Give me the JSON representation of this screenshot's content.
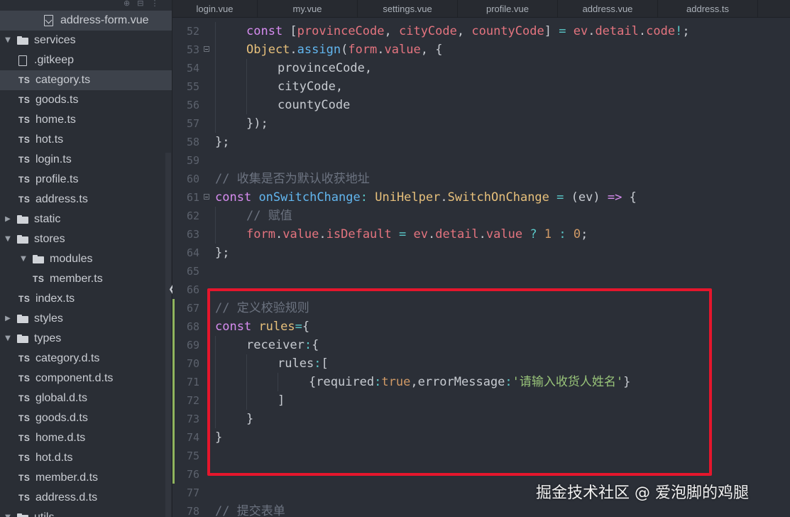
{
  "tabs": [
    {
      "label": "login.vue"
    },
    {
      "label": "my.vue"
    },
    {
      "label": "settings.vue"
    },
    {
      "label": "profile.vue"
    },
    {
      "label": "address.vue"
    },
    {
      "label": "address.ts"
    }
  ],
  "explorer": {
    "items": [
      {
        "label": "address-form.vue",
        "kind": "vue",
        "depth": 3,
        "selected": false
      },
      {
        "label": "services",
        "kind": "folder",
        "depth": 0,
        "expanded": true
      },
      {
        "label": ".gitkeep",
        "kind": "file",
        "depth": 1
      },
      {
        "label": "category.ts",
        "kind": "ts",
        "depth": 1,
        "selected": true
      },
      {
        "label": "goods.ts",
        "kind": "ts",
        "depth": 1
      },
      {
        "label": "home.ts",
        "kind": "ts",
        "depth": 1
      },
      {
        "label": "hot.ts",
        "kind": "ts",
        "depth": 1
      },
      {
        "label": "login.ts",
        "kind": "ts",
        "depth": 1
      },
      {
        "label": "profile.ts",
        "kind": "ts",
        "depth": 1
      },
      {
        "label": "address.ts",
        "kind": "ts",
        "depth": 1
      },
      {
        "label": "static",
        "kind": "folder",
        "depth": 0,
        "expanded": false
      },
      {
        "label": "stores",
        "kind": "folder",
        "depth": 0,
        "expanded": true
      },
      {
        "label": "modules",
        "kind": "folder",
        "depth": 1,
        "expanded": true
      },
      {
        "label": "member.ts",
        "kind": "ts",
        "depth": 2
      },
      {
        "label": "index.ts",
        "kind": "ts",
        "depth": 1
      },
      {
        "label": "styles",
        "kind": "folder",
        "depth": 0,
        "expanded": false
      },
      {
        "label": "types",
        "kind": "folder",
        "depth": 0,
        "expanded": true
      },
      {
        "label": "category.d.ts",
        "kind": "ts",
        "depth": 1
      },
      {
        "label": "component.d.ts",
        "kind": "ts",
        "depth": 1
      },
      {
        "label": "global.d.ts",
        "kind": "ts",
        "depth": 1
      },
      {
        "label": "goods.d.ts",
        "kind": "ts",
        "depth": 1
      },
      {
        "label": "home.d.ts",
        "kind": "ts",
        "depth": 1
      },
      {
        "label": "hot.d.ts",
        "kind": "ts",
        "depth": 1
      },
      {
        "label": "member.d.ts",
        "kind": "ts",
        "depth": 1
      },
      {
        "label": "address.d.ts",
        "kind": "ts",
        "depth": 1
      },
      {
        "label": "utils",
        "kind": "folder",
        "depth": 0,
        "expanded": true
      }
    ]
  },
  "editor": {
    "lines": [
      {
        "n": "52",
        "fold": false,
        "indent": 1,
        "tokens": [
          [
            "kw",
            "const"
          ],
          [
            "pl",
            " ["
          ],
          [
            "vr",
            "provinceCode"
          ],
          [
            "pl",
            ", "
          ],
          [
            "vr",
            "cityCode"
          ],
          [
            "pl",
            ", "
          ],
          [
            "vr",
            "countyCode"
          ],
          [
            "pl",
            "] "
          ],
          [
            "op",
            "="
          ],
          [
            "pl",
            " "
          ],
          [
            "vr",
            "ev"
          ],
          [
            "pl",
            "."
          ],
          [
            "vr",
            "detail"
          ],
          [
            "pl",
            "."
          ],
          [
            "vr",
            "code"
          ],
          [
            "op",
            "!"
          ],
          [
            "pl",
            ";"
          ]
        ]
      },
      {
        "n": "53",
        "fold": true,
        "indent": 1,
        "tokens": [
          [
            "ty",
            "Object"
          ],
          [
            "pl",
            "."
          ],
          [
            "fn",
            "assign"
          ],
          [
            "pl",
            "("
          ],
          [
            "vr",
            "form"
          ],
          [
            "pl",
            "."
          ],
          [
            "vr",
            "value"
          ],
          [
            "pl",
            ", {"
          ]
        ]
      },
      {
        "n": "54",
        "fold": false,
        "indent": 2,
        "tokens": [
          [
            "pl",
            "provinceCode,"
          ]
        ]
      },
      {
        "n": "55",
        "fold": false,
        "indent": 2,
        "tokens": [
          [
            "pl",
            "cityCode,"
          ]
        ]
      },
      {
        "n": "56",
        "fold": false,
        "indent": 2,
        "tokens": [
          [
            "pl",
            "countyCode"
          ]
        ]
      },
      {
        "n": "57",
        "fold": false,
        "indent": 1,
        "tokens": [
          [
            "pl",
            "});"
          ]
        ]
      },
      {
        "n": "58",
        "fold": false,
        "indent": 0,
        "tokens": [
          [
            "pl",
            "};"
          ]
        ]
      },
      {
        "n": "59",
        "fold": false,
        "indent": 0,
        "tokens": []
      },
      {
        "n": "60",
        "fold": false,
        "indent": 0,
        "tokens": [
          [
            "cmt",
            "// 收集是否为默认收获地址"
          ]
        ]
      },
      {
        "n": "61",
        "fold": true,
        "indent": 0,
        "tokens": [
          [
            "kw",
            "const"
          ],
          [
            "pl",
            " "
          ],
          [
            "fn",
            "onSwitchChange"
          ],
          [
            "op",
            ":"
          ],
          [
            "pl",
            " "
          ],
          [
            "ty",
            "UniHelper"
          ],
          [
            "pl",
            "."
          ],
          [
            "ty",
            "SwitchOnChange"
          ],
          [
            "pl",
            " "
          ],
          [
            "op",
            "="
          ],
          [
            "pl",
            " ("
          ],
          [
            "pl",
            "ev"
          ],
          [
            "pl",
            ") "
          ],
          [
            "kw",
            "=>"
          ],
          [
            "pl",
            " {"
          ]
        ]
      },
      {
        "n": "62",
        "fold": false,
        "indent": 1,
        "tokens": [
          [
            "cmt",
            "// 赋值"
          ]
        ]
      },
      {
        "n": "63",
        "fold": false,
        "indent": 1,
        "tokens": [
          [
            "vr",
            "form"
          ],
          [
            "pl",
            "."
          ],
          [
            "vr",
            "value"
          ],
          [
            "pl",
            "."
          ],
          [
            "vr",
            "isDefault"
          ],
          [
            "pl",
            " "
          ],
          [
            "op",
            "="
          ],
          [
            "pl",
            " "
          ],
          [
            "vr",
            "ev"
          ],
          [
            "pl",
            "."
          ],
          [
            "vr",
            "detail"
          ],
          [
            "pl",
            "."
          ],
          [
            "vr",
            "value"
          ],
          [
            "pl",
            " "
          ],
          [
            "op",
            "?"
          ],
          [
            "pl",
            " "
          ],
          [
            "num",
            "1"
          ],
          [
            "pl",
            " "
          ],
          [
            "op",
            ":"
          ],
          [
            "pl",
            " "
          ],
          [
            "num",
            "0"
          ],
          [
            "pl",
            ";"
          ]
        ]
      },
      {
        "n": "64",
        "fold": false,
        "indent": 0,
        "tokens": [
          [
            "pl",
            "};"
          ]
        ]
      },
      {
        "n": "65",
        "fold": false,
        "indent": 0,
        "tokens": []
      },
      {
        "n": "66",
        "fold": false,
        "indent": 0,
        "tokens": []
      },
      {
        "n": "67",
        "fold": false,
        "indent": 0,
        "tokens": [
          [
            "cmt",
            "// 定义校验规则"
          ]
        ]
      },
      {
        "n": "68",
        "fold": false,
        "indent": 0,
        "tokens": [
          [
            "kw",
            "const"
          ],
          [
            "pl",
            " "
          ],
          [
            "ty",
            "rules"
          ],
          [
            "op",
            "="
          ],
          [
            "pl",
            "{"
          ]
        ]
      },
      {
        "n": "69",
        "fold": false,
        "indent": 1,
        "tokens": [
          [
            "pl",
            "receiver"
          ],
          [
            "op",
            ":"
          ],
          [
            "pl",
            "{"
          ]
        ]
      },
      {
        "n": "70",
        "fold": false,
        "indent": 2,
        "tokens": [
          [
            "pl",
            "rules"
          ],
          [
            "op",
            ":"
          ],
          [
            "pl",
            "["
          ]
        ]
      },
      {
        "n": "71",
        "fold": false,
        "indent": 3,
        "tokens": [
          [
            "pl",
            "{"
          ],
          [
            "pl",
            "required"
          ],
          [
            "op",
            ":"
          ],
          [
            "num",
            "true"
          ],
          [
            "pl",
            ","
          ],
          [
            "pl",
            "errorMessage"
          ],
          [
            "op",
            ":"
          ],
          [
            "str",
            "'请输入收货人姓名'"
          ],
          [
            "pl",
            "}"
          ]
        ]
      },
      {
        "n": "72",
        "fold": false,
        "indent": 2,
        "tokens": [
          [
            "pl",
            "]"
          ]
        ]
      },
      {
        "n": "73",
        "fold": false,
        "indent": 1,
        "tokens": [
          [
            "pl",
            "}"
          ]
        ]
      },
      {
        "n": "74",
        "fold": false,
        "indent": 0,
        "tokens": [
          [
            "pl",
            "}"
          ]
        ]
      },
      {
        "n": "75",
        "fold": false,
        "indent": 0,
        "tokens": []
      },
      {
        "n": "76",
        "fold": false,
        "indent": 0,
        "tokens": []
      },
      {
        "n": "77",
        "fold": false,
        "indent": 0,
        "tokens": []
      },
      {
        "n": "78",
        "fold": false,
        "indent": 0,
        "tokens": [
          [
            "cmt",
            "// 提交表单"
          ]
        ]
      }
    ]
  },
  "watermark": "掘金技术社区 @ 爱泡脚的鸡腿",
  "colors": {
    "highlight": "#e5162c",
    "modified": "#8fb45d"
  }
}
